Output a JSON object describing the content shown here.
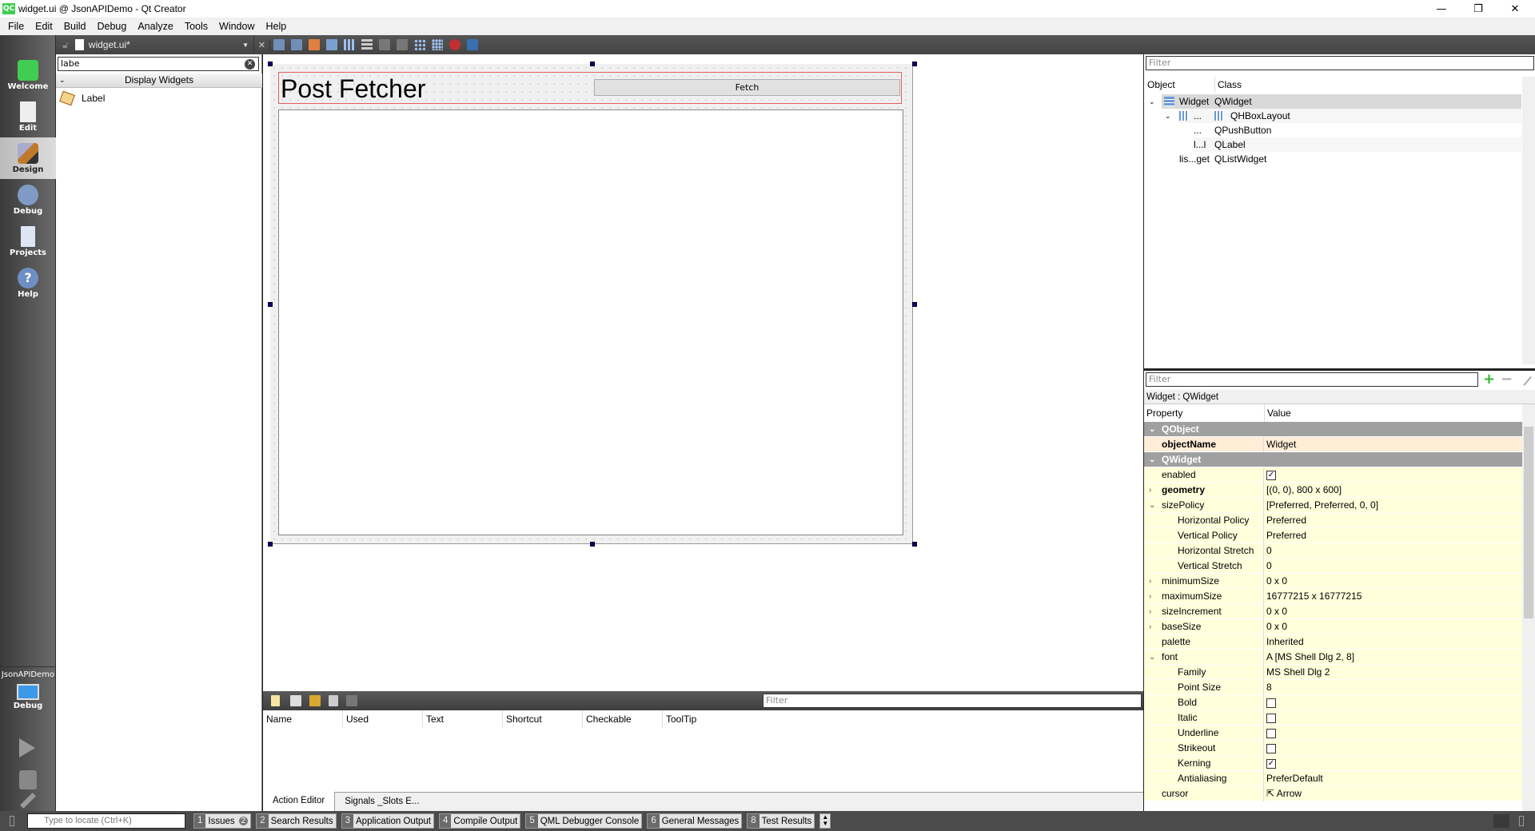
{
  "window": {
    "title": "widget.ui @ JsonAPIDemo - Qt Creator",
    "logo": "QC",
    "minimize": "—",
    "restore": "❐",
    "close": "✕"
  },
  "menu": [
    "File",
    "Edit",
    "Build",
    "Debug",
    "Analyze",
    "Tools",
    "Window",
    "Help"
  ],
  "editor_toolbar": {
    "file_name": "widget.ui*"
  },
  "modes": [
    {
      "label": "Welcome",
      "icon": "qt-logo-icon",
      "color": "#41cd52"
    },
    {
      "label": "Edit",
      "icon": "document-icon",
      "color": "#eeeeee"
    },
    {
      "label": "Design",
      "icon": "design-pencil-icon",
      "color": "#c0782a",
      "active": true
    },
    {
      "label": "Debug",
      "icon": "bug-icon",
      "color": "#7f9bc4"
    },
    {
      "label": "Projects",
      "icon": "folder-icon",
      "color": "#dde6f2"
    },
    {
      "label": "Help",
      "icon": "help-icon",
      "color": "#6d8fc4"
    }
  ],
  "kit": {
    "project": "JsonAPIDemo",
    "mode": "Debug"
  },
  "widget_box": {
    "filter_value": "labe",
    "category": "Display Widgets",
    "items": [
      "Label"
    ]
  },
  "form": {
    "label_text": "Post Fetcher",
    "button_text": "Fetch"
  },
  "action_editor": {
    "filter_placeholder": "Filter",
    "columns": [
      "Name",
      "Used",
      "Text",
      "Shortcut",
      "Checkable",
      "ToolTip"
    ],
    "tabs": [
      "Action Editor",
      "Signals _Slots E..."
    ]
  },
  "object_inspector": {
    "filter_placeholder": "Filter",
    "columns": [
      "Object",
      "Class"
    ],
    "rows": [
      {
        "object": "Widget",
        "class": "QWidget",
        "level": 0,
        "selected": true
      },
      {
        "object": "...",
        "class": "QHBoxLayout",
        "level": 1
      },
      {
        "object": "...",
        "class": "QPushButton",
        "level": 2
      },
      {
        "object": "l...l",
        "class": "QLabel",
        "level": 2
      },
      {
        "object": "lis...get",
        "class": "QListWidget",
        "level": 1
      }
    ]
  },
  "property_editor": {
    "filter_placeholder": "Filter",
    "title": "Widget : QWidget",
    "columns": [
      "Property",
      "Value"
    ],
    "rows": [
      {
        "type": "sec",
        "name": "QObject"
      },
      {
        "type": "org",
        "name": "objectName",
        "value": "Widget",
        "bold": true
      },
      {
        "type": "sec",
        "name": "QWidget"
      },
      {
        "type": "yel",
        "name": "enabled",
        "check": true
      },
      {
        "type": "yel",
        "name": "geometry",
        "value": "[(0, 0), 800 x 600]",
        "bold": true,
        "arrow": "›"
      },
      {
        "type": "yel",
        "name": "sizePolicy",
        "value": "[Preferred, Preferred, 0, 0]",
        "arrow": "⌄"
      },
      {
        "type": "yel",
        "name": "Horizontal Policy",
        "value": "Preferred",
        "sub": true
      },
      {
        "type": "yel",
        "name": "Vertical Policy",
        "value": "Preferred",
        "sub": true
      },
      {
        "type": "yel",
        "name": "Horizontal Stretch",
        "value": "0",
        "sub": true
      },
      {
        "type": "yel",
        "name": "Vertical Stretch",
        "value": "0",
        "sub": true
      },
      {
        "type": "yel",
        "name": "minimumSize",
        "value": "0 x 0",
        "arrow": "›"
      },
      {
        "type": "yel",
        "name": "maximumSize",
        "value": "16777215 x 16777215",
        "arrow": "›"
      },
      {
        "type": "yel",
        "name": "sizeIncrement",
        "value": "0 x 0",
        "arrow": "›"
      },
      {
        "type": "yel",
        "name": "baseSize",
        "value": "0 x 0",
        "arrow": "›"
      },
      {
        "type": "yel",
        "name": "palette",
        "value": "Inherited"
      },
      {
        "type": "yel",
        "name": "font",
        "value": "A  [MS Shell Dlg 2, 8]",
        "arrow": "⌄"
      },
      {
        "type": "yel",
        "name": "Family",
        "value": "MS Shell Dlg 2",
        "sub": true
      },
      {
        "type": "yel",
        "name": "Point Size",
        "value": "8",
        "sub": true
      },
      {
        "type": "yel",
        "name": "Bold",
        "check": false,
        "sub": true
      },
      {
        "type": "yel",
        "name": "Italic",
        "check": false,
        "sub": true
      },
      {
        "type": "yel",
        "name": "Underline",
        "check": false,
        "sub": true
      },
      {
        "type": "yel",
        "name": "Strikeout",
        "check": false,
        "sub": true
      },
      {
        "type": "yel",
        "name": "Kerning",
        "check": true,
        "sub": true
      },
      {
        "type": "yel",
        "name": "Antialiasing",
        "value": "PreferDefault",
        "sub": true
      },
      {
        "type": "yel",
        "name": "cursor",
        "value": "⇱  Arrow"
      }
    ]
  },
  "statusbar": {
    "locate_placeholder": "Type to locate (Ctrl+K)",
    "panes": [
      {
        "n": "1",
        "label": "Issues",
        "badge": "2"
      },
      {
        "n": "2",
        "label": "Search Results"
      },
      {
        "n": "3",
        "label": "Application Output"
      },
      {
        "n": "4",
        "label": "Compile Output"
      },
      {
        "n": "5",
        "label": "QML Debugger Console"
      },
      {
        "n": "6",
        "label": "General Messages"
      },
      {
        "n": "8",
        "label": "Test Results"
      }
    ]
  }
}
